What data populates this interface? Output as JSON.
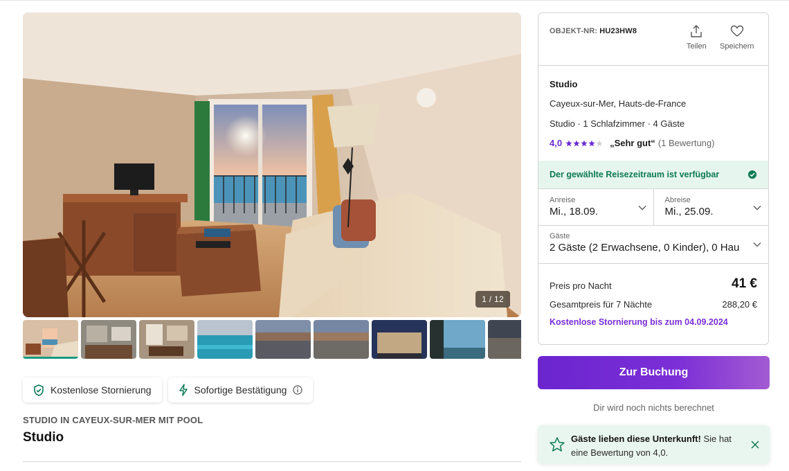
{
  "gallery": {
    "counter": "1 / 12",
    "thumbnails": [
      "thumb-1",
      "thumb-2",
      "thumb-3",
      "thumb-4",
      "thumb-5",
      "thumb-6",
      "thumb-7",
      "thumb-8",
      "thumb-9"
    ]
  },
  "badges": {
    "cancellation": "Kostenlose Stornierung",
    "confirmation": "Sofortige Bestätigung"
  },
  "listing": {
    "subtitle": "STUDIO IN CAYEUX-SUR-MER MIT POOL",
    "title": "Studio"
  },
  "card": {
    "object_label": "OBJEKT-NR:",
    "object_number": "HU23HW8",
    "share_label": "Teilen",
    "save_label": "Speichern",
    "name": "Studio",
    "location": "Cayeux-sur-Mer, Hauts-de-France",
    "facts": "Studio · 1 Schlafzimmer · 4 Gäste",
    "rating_score": "4,0",
    "rating_stars": 4,
    "rating_quote": "„Sehr gut“",
    "rating_count": "(1 Bewertung)",
    "availability": "Der gewählte Reisezeitraum ist verfügbar",
    "arrival_label": "Anreise",
    "arrival_value": "Mi., 18.09.",
    "departure_label": "Abreise",
    "departure_value": "Mi., 25.09.",
    "guests_label": "Gäste",
    "guests_value": "2 Gäste (2 Erwachsene, 0 Kinder), 0 Hau",
    "price_night_label": "Preis pro Nacht",
    "price_night_value": "41 €",
    "total_label": "Gesamtpreis für 7 Nächte",
    "total_value": "288,20 €",
    "free_cancel": "Kostenlose Stornierung bis zum 04.09.2024"
  },
  "booking": {
    "button": "Zur Buchung",
    "note": "Dir wird noch nichts berechnet"
  },
  "toast": {
    "bold": "Gäste lieben diese Unterkunft!",
    "text": " Sie hat eine Bewertung von 4,0."
  },
  "colors": {
    "accent_purple": "#6b25cf",
    "success_green": "#0d7a55",
    "teal": "#149a82"
  }
}
